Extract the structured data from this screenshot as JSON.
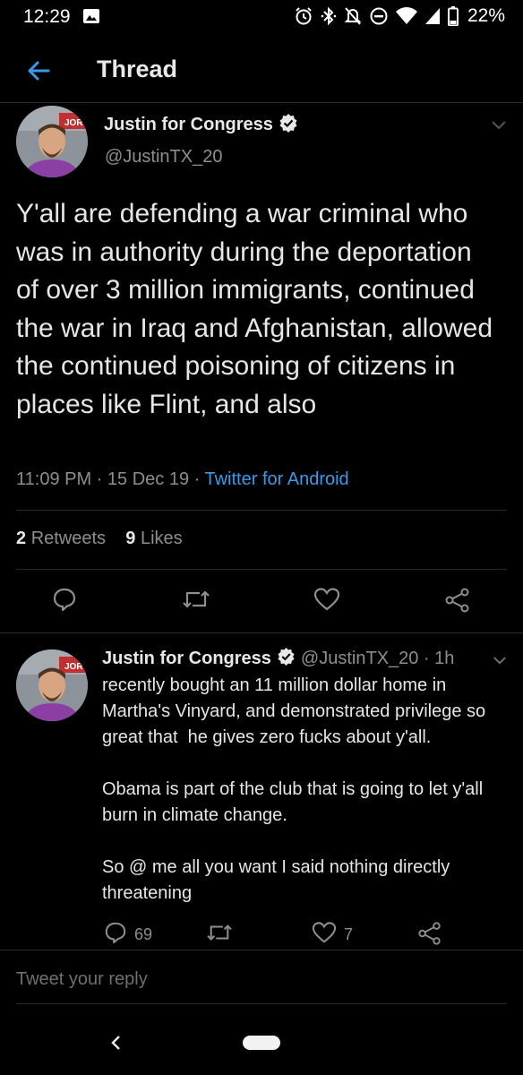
{
  "status_bar": {
    "time": "12:29",
    "battery": "22%",
    "icons": [
      "image-icon",
      "alarm-icon",
      "bluetooth-icon",
      "mute-icon",
      "do-not-disturb-icon",
      "wifi-icon",
      "signal-icon",
      "battery-icon"
    ]
  },
  "header": {
    "title": "Thread"
  },
  "main_tweet": {
    "author_name": "Justin for Congress",
    "handle": "@JustinTX_20",
    "text": "Y'all are defending a war criminal who was in authority during the deportation of over 3 million immigrants, continued the war in Iraq and Afghanistan, allowed the continued poisoning of citizens in places like Flint, and also",
    "time": "11:09 PM",
    "date": "15 Dec 19",
    "source": "Twitter for Android",
    "retweets_count": "2",
    "retweets_label": "Retweets",
    "likes_count": "9",
    "likes_label": "Likes"
  },
  "reply_tweet": {
    "author_name": "Justin for Congress",
    "handle_time": "@JustinTX_20 · 1h",
    "text": "recently bought an 11 million dollar home in Martha's Vinyard, and demonstrated privilege so great that  he gives zero fucks about y'all.\n\nObama is part of the club that is going to let y'all burn in climate change.\n\nSo @ me all you want I said nothing directly threatening",
    "reply_count": "69",
    "like_count": "7"
  },
  "reply_box": {
    "placeholder": "Tweet your reply"
  },
  "colors": {
    "background": "#000000",
    "link": "#3a9ae8",
    "verified": "#e8e8e8",
    "muted": "#8e8e8e"
  }
}
